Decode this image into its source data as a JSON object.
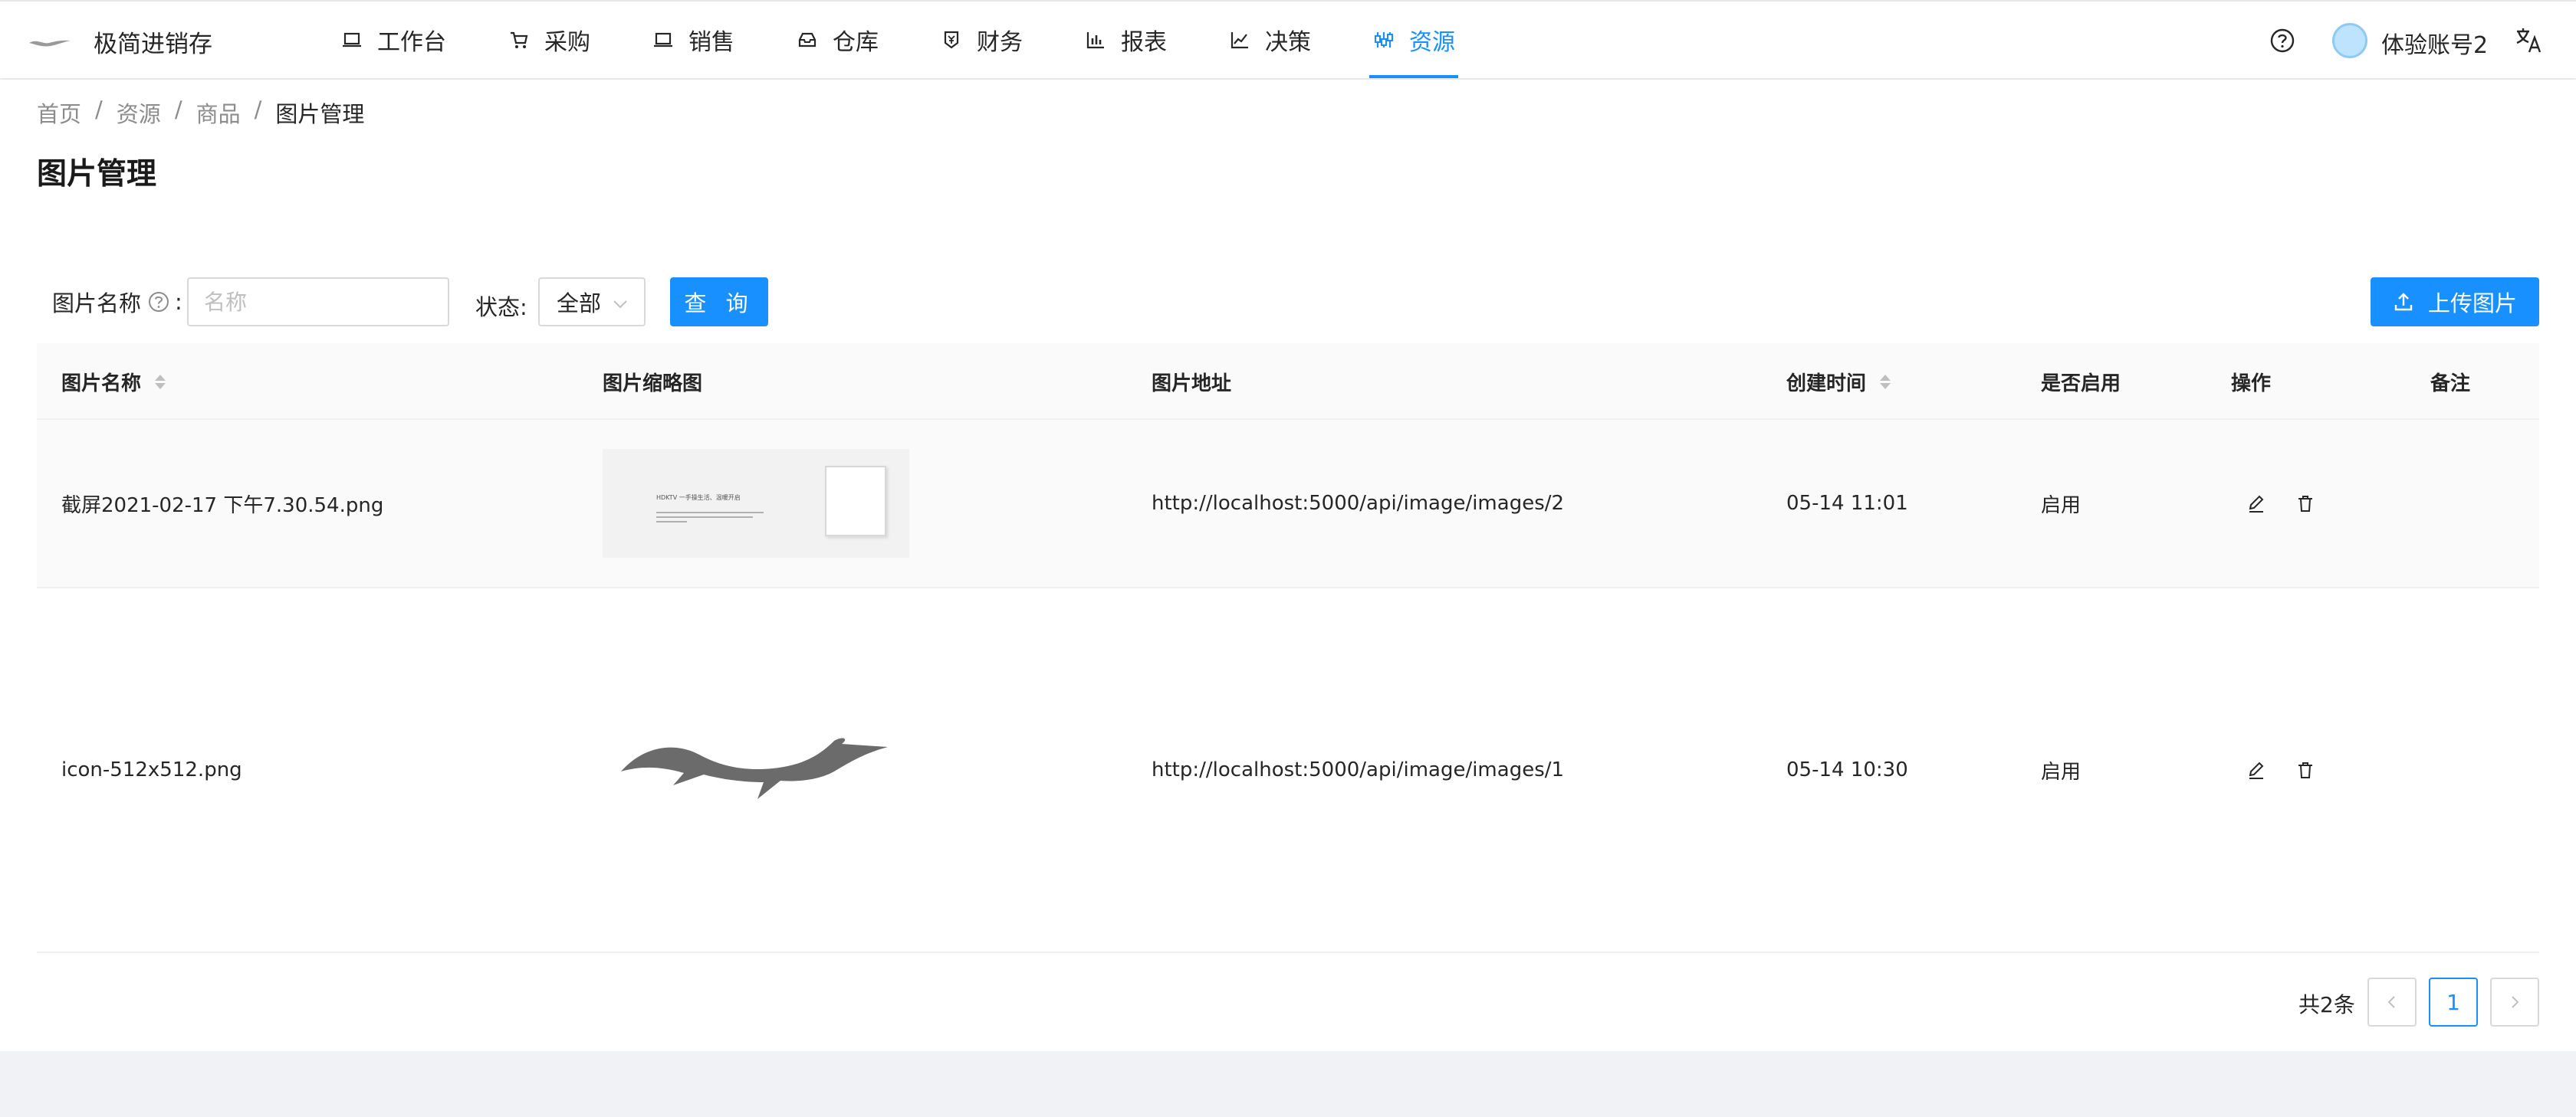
{
  "app": {
    "title": "极简进销存",
    "accent_color": "#1890ff",
    "logo_icon": "wing-logo-icon"
  },
  "nav": [
    {
      "label": "工作台",
      "icon": "laptop-icon"
    },
    {
      "label": "采购",
      "icon": "cart-icon"
    },
    {
      "label": "销售",
      "icon": "laptop-icon"
    },
    {
      "label": "仓库",
      "icon": "inbox-icon"
    },
    {
      "label": "财务",
      "icon": "money-collect-icon"
    },
    {
      "label": "报表",
      "icon": "bar-chart-icon"
    },
    {
      "label": "决策",
      "icon": "line-chart-icon"
    },
    {
      "label": "资源",
      "icon": "sliders-icon",
      "active": true
    }
  ],
  "header": {
    "user_name": "体验账号2",
    "help_icon": "question-circle-icon",
    "lang_icon": "translate-icon"
  },
  "breadcrumb": {
    "items": [
      "首页",
      "资源",
      "商品"
    ],
    "separator": "/",
    "current": "图片管理"
  },
  "page_title": "图片管理",
  "filter": {
    "name_label": "图片名称",
    "name_placeholder": "名称",
    "status_label": "状态:",
    "status_value": "全部",
    "query_button": "查 询",
    "colon": ":"
  },
  "upload_button": "上传图片",
  "table": {
    "columns": [
      "图片名称",
      "图片缩略图",
      "图片地址",
      "创建时间",
      "是否启用",
      "操作",
      "备注"
    ],
    "rows": [
      {
        "name": "截屏2021-02-17 下午7.30.54.png",
        "url": "http://localhost:5000/api/image/images/2",
        "created": "05-14 11:01",
        "enabled": "启用",
        "remark": "",
        "thumb_caption": "HDKTV 一手操生活、温暖开启"
      },
      {
        "name": "icon-512x512.png",
        "url": "http://localhost:5000/api/image/images/1",
        "created": "05-14 10:30",
        "enabled": "启用",
        "remark": ""
      }
    ]
  },
  "pagination": {
    "total_text": "共2条",
    "current_page": "1"
  }
}
